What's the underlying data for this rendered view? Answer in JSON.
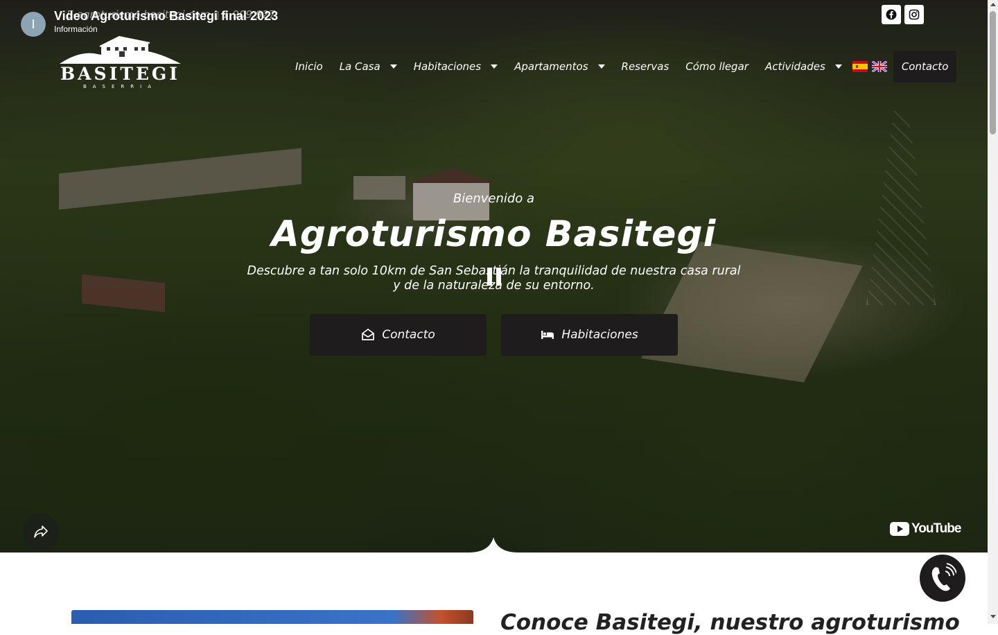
{
  "youtube": {
    "avatar_letter": "I",
    "video_title": "Video Agroturismo Basitegi final 2023",
    "channel_name": "Información",
    "brand": "YouTube"
  },
  "topbar": {
    "contact_text": "E-agroturismo basitegi.com  ▯ 1 909 927"
  },
  "brand": {
    "logo_text": "BASITEGI",
    "logo_sub": "BASERRIA"
  },
  "nav": {
    "items": [
      {
        "label": "Inicio",
        "dropdown": false
      },
      {
        "label": "La Casa",
        "dropdown": true
      },
      {
        "label": "Habitaciones",
        "dropdown": true
      },
      {
        "label": "Apartamentos",
        "dropdown": true
      },
      {
        "label": "Reservas",
        "dropdown": false
      },
      {
        "label": "Cómo llegar",
        "dropdown": false
      },
      {
        "label": "Actividades",
        "dropdown": true
      }
    ],
    "contact_label": "Contacto"
  },
  "hero": {
    "welcome": "Bienvenido a",
    "headline": "Agroturismo Basitegi",
    "tagline_line1": "Descubre a tan solo 10km de San Sebastián la tranquilidad de nuestra casa rural",
    "tagline_line2": "y de la naturaleza de su entorno.",
    "cta_contact": "Contacto",
    "cta_rooms": "Habitaciones"
  },
  "about": {
    "title": "Conoce Basitegi, nuestro agroturismo"
  },
  "colors": {
    "button_bg": "#1e1c1d",
    "text_light": "#ffffff",
    "text_dark": "#222222"
  }
}
